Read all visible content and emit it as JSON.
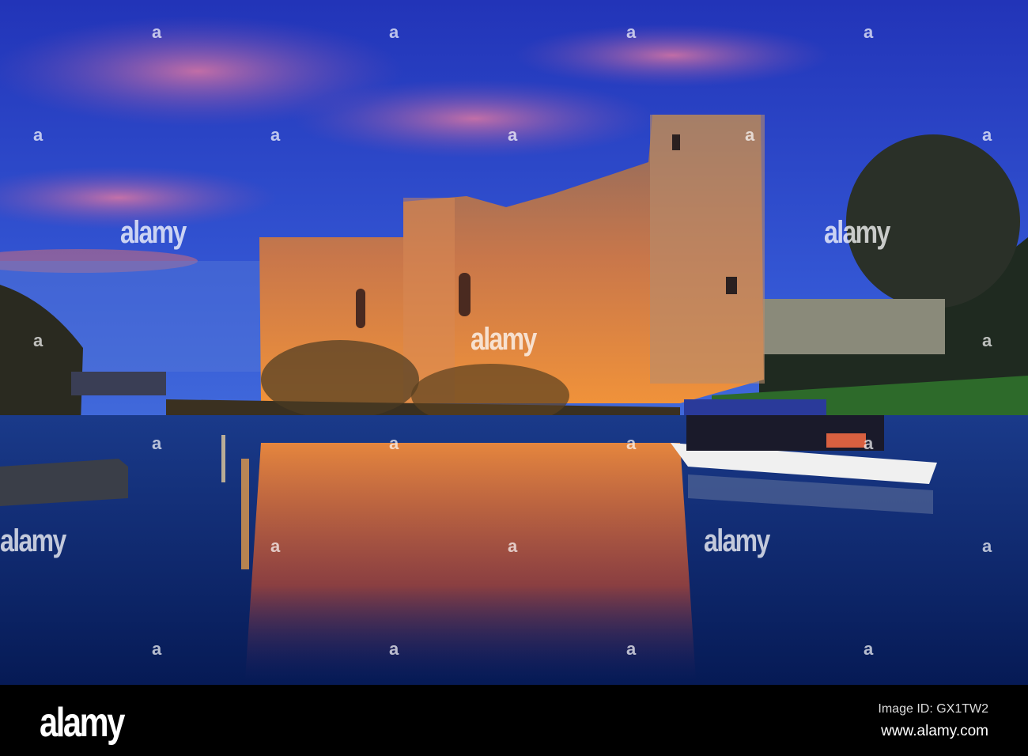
{
  "watermark": {
    "text": "alamy",
    "small": "a"
  },
  "footer": {
    "logo": "alamy",
    "image_id": "Image ID: GX1TW2",
    "website": "www.alamy.com"
  },
  "colors": {
    "sky_top": "#2a3fd0",
    "sky_horizon": "#3a6fd8",
    "castle_glow": "#e8864a",
    "water": "#0d2e78"
  }
}
